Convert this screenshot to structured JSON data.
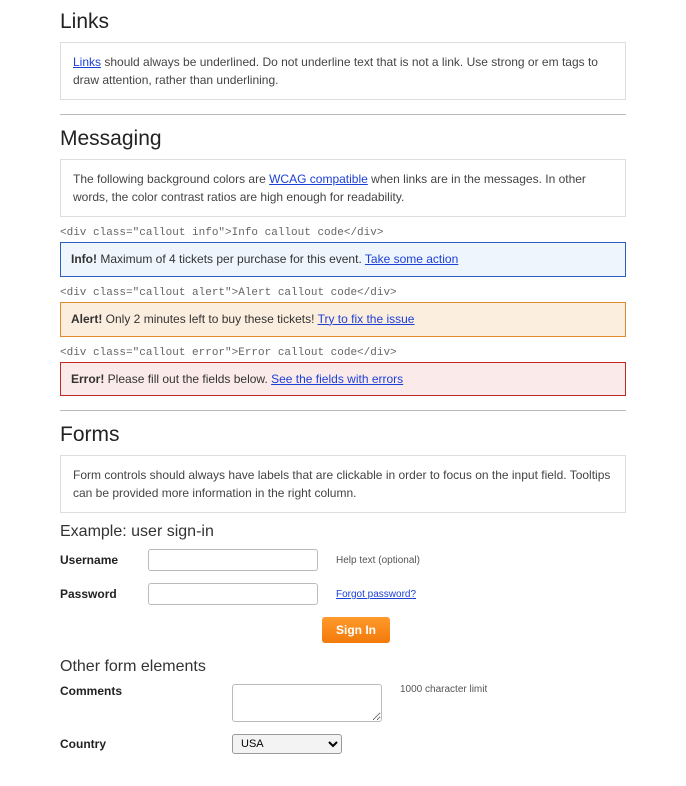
{
  "links": {
    "heading": "Links",
    "link_word": "Links",
    "desc_rest": " should always be underlined. Do not underline text that is not a link. Use strong or em tags to draw attention, rather than underlining."
  },
  "messaging": {
    "heading": "Messaging",
    "desc_pre": "The following background colors are ",
    "desc_link": "WCAG compatible",
    "desc_post": " when links are in the messages. In other words, the color contrast ratios are high enough for readability.",
    "info_code": "<div class=\"callout info\">Info callout code</div>",
    "info_lead": "Info!",
    "info_text": " Maximum of 4 tickets per purchase for this event. ",
    "info_link": "Take some action",
    "alert_code": "<div class=\"callout alert\">Alert callout code</div>",
    "alert_lead": "Alert!",
    "alert_text": " Only 2 minutes left to buy these tickets! ",
    "alert_link": "Try to fix the issue",
    "error_code": "<div class=\"callout error\">Error callout code</div>",
    "error_lead": "Error!",
    "error_text": " Please fill out the fields below. ",
    "error_link": "See the fields with errors"
  },
  "forms": {
    "heading": "Forms",
    "desc": "Form controls should always have labels that are clickable in order to focus on the input field. Tooltips can be provided more information in the right column.",
    "example_heading": "Example: user sign-in",
    "username_label": "Username",
    "username_help": "Help text (optional)",
    "password_label": "Password",
    "forgot_link": "Forgot password?",
    "signin_btn": "Sign In",
    "other_heading": "Other form elements",
    "comments_label": "Comments",
    "comments_help": "1000 character limit",
    "country_label": "Country",
    "country_value": "USA"
  }
}
